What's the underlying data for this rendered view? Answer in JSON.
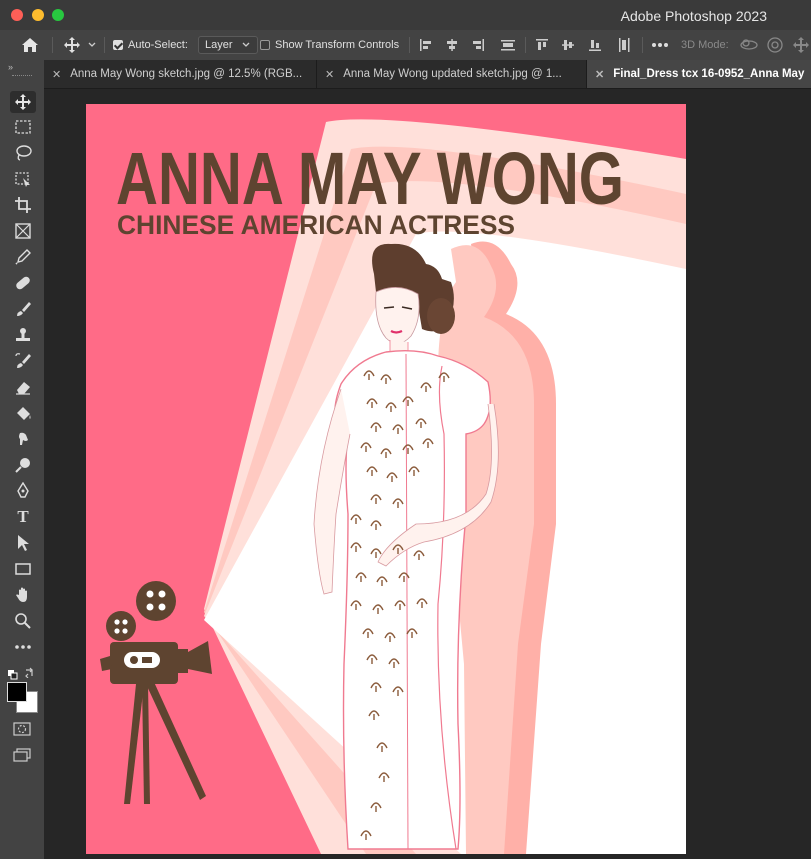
{
  "window": {
    "title": "Adobe Photoshop 2023"
  },
  "options_bar": {
    "auto_select_label": "Auto-Select:",
    "auto_select_checked": true,
    "auto_select_value": "Layer",
    "show_transform_label": "Show Transform Controls",
    "show_transform_checked": false,
    "mode_3d_label": "3D Mode:"
  },
  "tabs": [
    {
      "label": "Anna May Wong sketch.jpg @ 12.5% (RGB...",
      "active": false
    },
    {
      "label": "Anna May Wong updated sketch.jpg @ 1...",
      "active": false
    },
    {
      "label": "Final_Dress tcx 16-0952_Anna May",
      "active": true
    }
  ],
  "tools": [
    {
      "icon": "move-tool-icon"
    },
    {
      "icon": "rectangular-marquee-icon"
    },
    {
      "icon": "lasso-icon"
    },
    {
      "icon": "object-selection-icon"
    },
    {
      "icon": "crop-icon"
    },
    {
      "icon": "frame-icon"
    },
    {
      "icon": "eyedropper-icon"
    },
    {
      "icon": "healing-brush-icon"
    },
    {
      "icon": "brush-icon"
    },
    {
      "icon": "clone-stamp-icon"
    },
    {
      "icon": "history-brush-icon"
    },
    {
      "icon": "eraser-icon"
    },
    {
      "icon": "paint-bucket-icon"
    },
    {
      "icon": "smudge-icon"
    },
    {
      "icon": "dodge-icon"
    },
    {
      "icon": "pen-icon"
    },
    {
      "icon": "type-icon",
      "glyph": "T"
    },
    {
      "icon": "path-selection-icon"
    },
    {
      "icon": "rectangle-shape-icon"
    },
    {
      "icon": "hand-icon"
    },
    {
      "icon": "zoom-icon"
    },
    {
      "icon": "more-tools-icon"
    }
  ],
  "document": {
    "title": "ANNA MAY WONG",
    "subtitle": "CHINESE AMERICAN ACTRESS"
  },
  "colors": {
    "pink": "#ff6b87",
    "beam_light": "#ffe0da",
    "beam_mid": "#ffc9c1",
    "beam_dark": "#ffb0a8",
    "brown": "#5e4430",
    "foreground": "#000000",
    "background": "#ffffff"
  }
}
